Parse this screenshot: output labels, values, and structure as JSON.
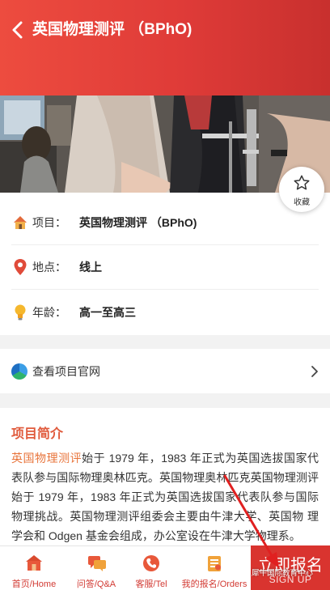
{
  "header": {
    "title": "英国物理测评 （BPhO)"
  },
  "favorite": {
    "label": "收藏"
  },
  "info": {
    "project_label": "项目：",
    "project_value": "英国物理测评 （BPhO)",
    "location_label": "地点：",
    "location_value": "线上",
    "age_label": "年龄：",
    "age_value": "高一至高三"
  },
  "official_site": {
    "label": "查看项目官网"
  },
  "intro": {
    "title": "项目简介",
    "highlight": "英国物理测评",
    "body": "始于 1979 年，1983 年正式为英国选拔国家代表队参与国际物理奥林匹克。英国物理奥林匹克英国物理测评始于 1979 年，1983 年正式为英国选拔国家代表队参与国际物理挑战。英国物理测评组委会主要由牛津大学、英国物 理学会和 Odgen 基金会组成，办公室设在牛津大学物理系。"
  },
  "tabbar": {
    "home": "首页/Home",
    "qa": "问答/Q&A",
    "tel": "客服/Tel",
    "orders": "我的报名/Orders",
    "signup_zh": "立即报名",
    "signup_en": "SIGN UP"
  },
  "watermark": "犀牛国际教育中心",
  "colors": {
    "brand_red": "#df3b38",
    "accent_orange": "#e05a3c",
    "tab_text": "#d23a33"
  }
}
